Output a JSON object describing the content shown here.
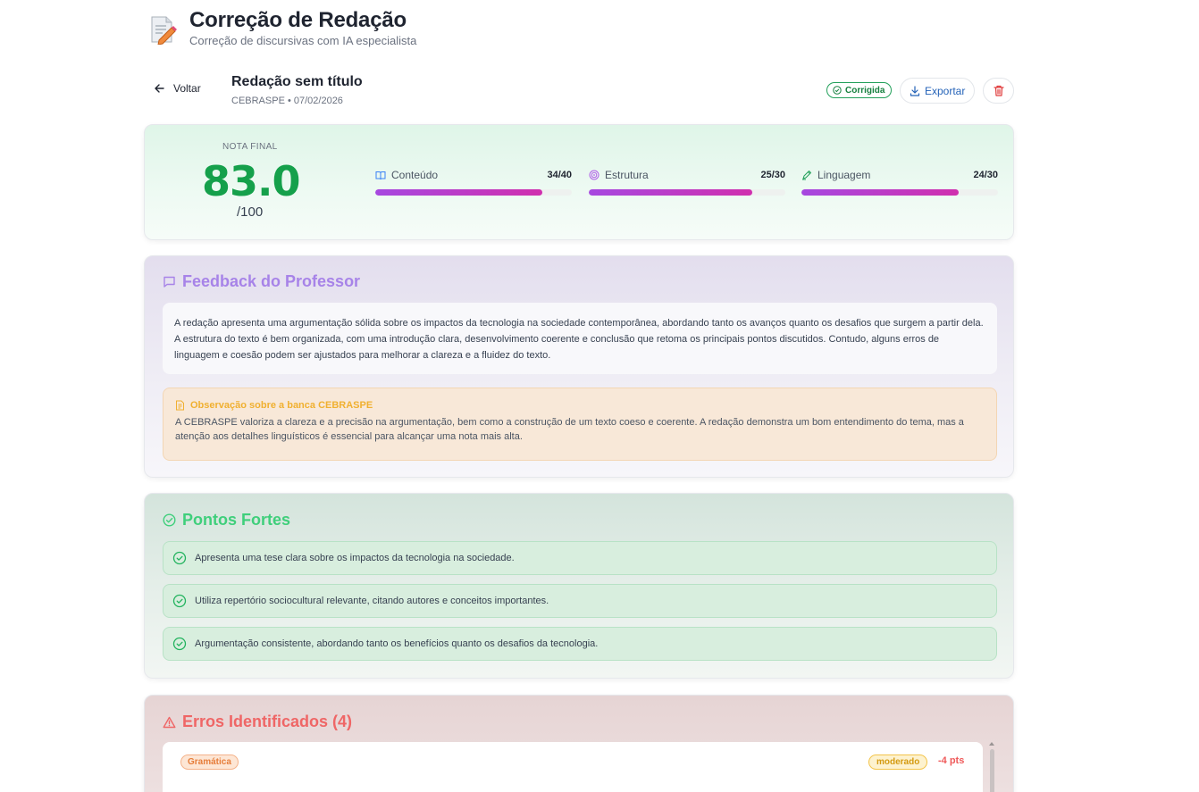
{
  "app": {
    "title": "Correção de Redação",
    "subtitle": "Correção de discursivas com IA especialista",
    "icon": "document-pencil-icon"
  },
  "toolbar": {
    "back_label": "Voltar",
    "essay_title": "Redação sem título",
    "essay_meta": "CEBRASPE • 07/02/2026",
    "status_label": "Corrigida",
    "export_label": "Exportar"
  },
  "score": {
    "label": "NOTA FINAL",
    "value": "83.0",
    "max": "/100",
    "metrics": [
      {
        "name": "Conteúdo",
        "score": "34/40",
        "fraction": 0.85,
        "icon": "book-icon"
      },
      {
        "name": "Estrutura",
        "score": "25/30",
        "fraction": 0.833,
        "icon": "target-icon"
      },
      {
        "name": "Linguagem",
        "score": "24/30",
        "fraction": 0.8,
        "icon": "pen-icon"
      }
    ]
  },
  "feedback": {
    "title": "Feedback do Professor",
    "text": "A redação apresenta uma argumentação sólida sobre os impactos da tecnologia na sociedade contemporânea, abordando tanto os avanços quanto os desafios que surgem a partir dela. A estrutura do texto é bem organizada, com uma introdução clara, desenvolvimento coerente e conclusão que retoma os principais pontos discutidos. Contudo, alguns erros de linguagem e coesão podem ser ajustados para melhorar a clareza e a fluidez do texto.",
    "note_title": "Observação sobre a banca CEBRASPE",
    "note_text": "A CEBRASPE valoriza a clareza e a precisão na argumentação, bem como a construção de um texto coeso e coerente. A redação demonstra um bom entendimento do tema, mas a atenção aos detalhes linguísticos é essencial para alcançar uma nota mais alta."
  },
  "strengths": {
    "title": "Pontos Fortes",
    "items": [
      "Apresenta uma tese clara sobre os impactos da tecnologia na sociedade.",
      "Utiliza repertório sociocultural relevante, citando autores e conceitos importantes.",
      "Argumentação consistente, abordando tanto os benefícios quanto os desafios da tecnologia."
    ]
  },
  "errors": {
    "title": "Erros Identificados (4)",
    "first": {
      "category": "Gramática",
      "severity": "moderado",
      "points": "-4 pts"
    }
  },
  "colors": {
    "score_green": "#15a04b",
    "feedback_purple": "#a783e8",
    "strengths_green": "#3fcf7b",
    "errors_red": "#ef6666",
    "bar_gradient_start": "#a648e0",
    "bar_gradient_end": "#d02fae"
  }
}
